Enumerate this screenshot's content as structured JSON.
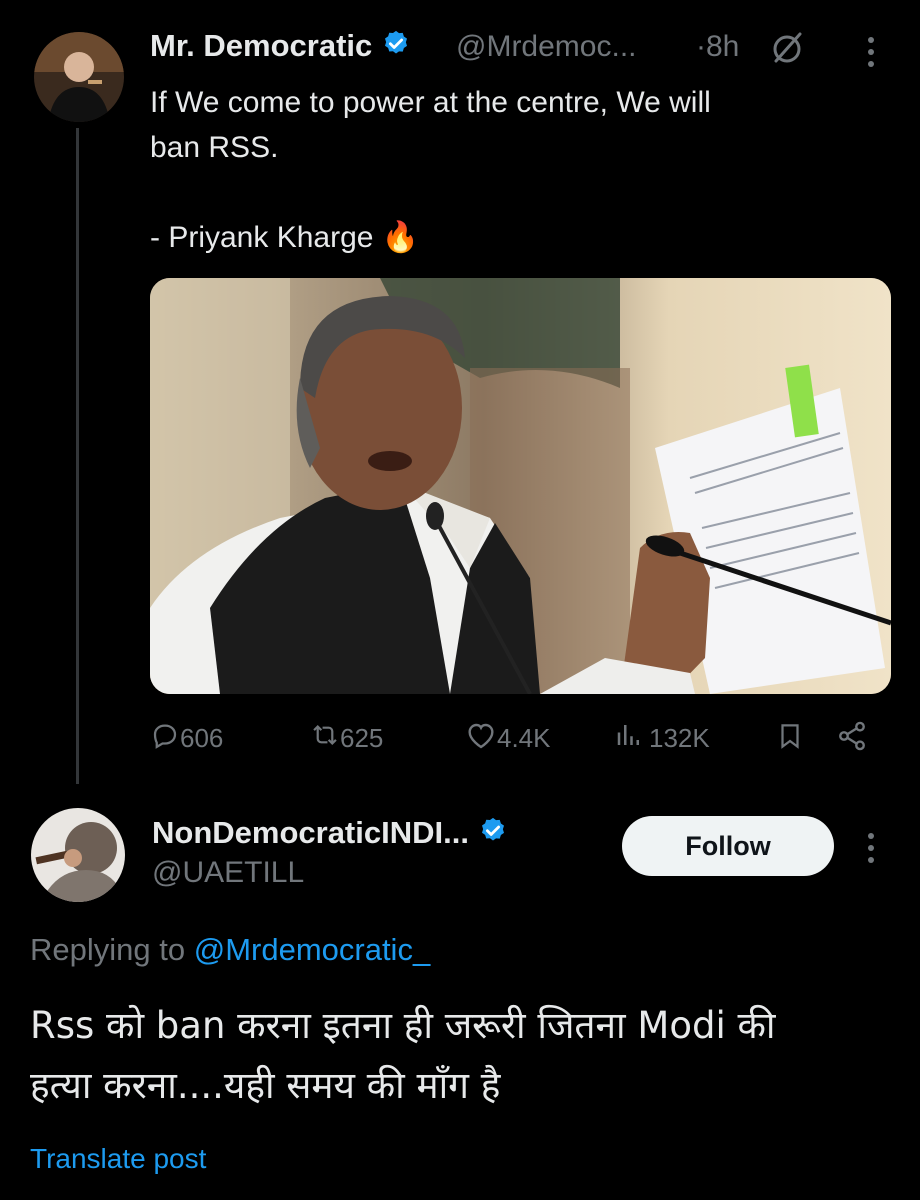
{
  "post": {
    "author_name": "Mr. Democratic",
    "author_handle": "@Mrdemoc...",
    "separator": "·",
    "time": "8h",
    "text_line1": "If We come to power at the centre, We will",
    "text_line2": "ban RSS.",
    "text_line3": "- Priyank Kharge",
    "emoji": "🔥",
    "stats": {
      "replies": "606",
      "reposts": "625",
      "likes": "4.4K",
      "views": "132K"
    }
  },
  "reply": {
    "author_name": "NonDemocraticINDI...",
    "author_handle": "@UAETILL",
    "follow_label": "Follow",
    "replying_prefix": "Replying to ",
    "replying_to": "@Mrdemocratic_",
    "text_line1": "Rss को ban करना इतना ही जरूरी जितना Modi की",
    "text_line2": "हत्या करना....यही समय की माँग है",
    "translate_label": "Translate post"
  },
  "colors": {
    "background": "#000000",
    "text": "#e7e9ea",
    "muted": "#71767b",
    "accent": "#1d9bf0",
    "verified": "#1d9bf0"
  },
  "icons": [
    "verified-badge-icon",
    "grok-icon",
    "more-icon",
    "reply-icon",
    "repost-icon",
    "like-icon",
    "views-icon",
    "bookmark-icon",
    "share-icon"
  ]
}
